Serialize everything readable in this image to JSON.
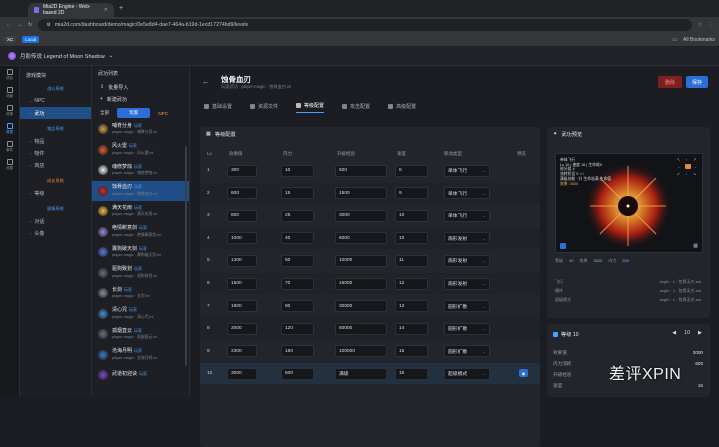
{
  "browser": {
    "tab_title": "Mia2D Engine - Web-based 2D",
    "url": "mia2d.com/dashboard/demo/magic/0e5e8d4-dae7-464a-b19d-1ecd17274bd9/levels",
    "bookmarks_label": "All Bookmarks",
    "chip1": "XC",
    "chip2": "Local"
  },
  "app": {
    "project": "月影传说 Legend of Moon Shadow"
  },
  "rail": [
    "项目",
    "场景",
    "资源",
    "数据",
    "事件",
    "设置"
  ],
  "tree": {
    "title": "游戏模块",
    "groups": [
      {
        "label": "战斗系统",
        "nodes": [
          "NPC",
          "武功"
        ]
      },
      {
        "label": "物品系统",
        "nodes": [
          "物品",
          "物件",
          "商店"
        ]
      },
      {
        "label": "成长系统",
        "nodes": [
          "等级"
        ]
      },
      {
        "label": "剧情系统",
        "nodes": [
          "对话",
          "头像"
        ]
      }
    ]
  },
  "list": {
    "title": "武功列表",
    "batch_import": "批量导入",
    "new_skill": "新建武功",
    "filters": [
      "全部",
      "玩家",
      "NPC"
    ],
    "items": [
      {
        "name": "哺脊分身",
        "tag": "玩家",
        "sub": "player-magic · 哺脊分身.ini",
        "color": "#d8a040"
      },
      {
        "name": "风火雷",
        "tag": "玩家",
        "sub": "player-magic · 风火雷.ini",
        "color": "#e06030"
      },
      {
        "name": "魂修梦烛",
        "tag": "玩家",
        "sub": "player-magic · 魂修梦烛.ini",
        "color": "#f0f0f0"
      },
      {
        "name": "蚀骨血刃",
        "tag": "玩家",
        "sub": "player-magic · 蚀骨血刃.ini",
        "color": "#d03030"
      },
      {
        "name": "满天花雨",
        "tag": "玩家",
        "sub": "player-magic · 满天花雨.ini",
        "color": "#f0c040"
      },
      {
        "name": "绝情断意剑",
        "tag": "玩家",
        "sub": "player-magic · 绝情断意剑.ini",
        "color": "#9a8cd8"
      },
      {
        "name": "骤狗破天剑",
        "tag": "玩家",
        "sub": "player-magic · 骤狗破天剑.ini",
        "color": "#5a7ad8"
      },
      {
        "name": "驱狗致划",
        "tag": "玩家",
        "sub": "player-magic · 驱狗致划.ini",
        "color": "#6a6f78"
      },
      {
        "name": "长剑",
        "tag": "玩家",
        "sub": "player-magic · 长剑.ini",
        "color": "#8a8f98"
      },
      {
        "name": "清心咒",
        "tag": "玩家",
        "sub": "player-magic · 清心咒.ini",
        "color": "#4a8fd0"
      },
      {
        "name": "孤烟直云",
        "tag": "玩家",
        "sub": "player-magic · 孤烟直云.ini",
        "color": "#6a7080"
      },
      {
        "name": "沧海月明",
        "tag": "玩家",
        "sub": "player-magic · 沧海月明.ini",
        "color": "#3a7ad0"
      },
      {
        "name": "武道初迎诀",
        "tag": "玩家",
        "sub": "",
        "color": "#7a4ad0"
      }
    ]
  },
  "main": {
    "title": "蚀骨血刃",
    "subtitle": "玩家武功 · player-magic · 蚀骨血刃.ini",
    "delete": "删除",
    "save": "保存",
    "tabs": [
      "基础设置",
      "资源文件",
      "等级配置",
      "攻击配置",
      "高级配置"
    ]
  },
  "levels": {
    "title": "等级配置",
    "headers": [
      "Lv",
      "效果值",
      "内力",
      "升级经验",
      "速度",
      "移动类型",
      "预览"
    ],
    "rows": [
      {
        "lv": "1",
        "eff": "300",
        "mana": "10",
        "exp": "500",
        "speed": "8",
        "move": "单体飞行"
      },
      {
        "lv": "2",
        "eff": "600",
        "mana": "15",
        "exp": "1500",
        "speed": "9",
        "move": "单体飞行"
      },
      {
        "lv": "3",
        "eff": "800",
        "mana": "25",
        "exp": "3000",
        "speed": "10",
        "move": "单体飞行"
      },
      {
        "lv": "4",
        "eff": "1000",
        "mana": "40",
        "exp": "6000",
        "speed": "10",
        "move": "扇形发射"
      },
      {
        "lv": "5",
        "eff": "1300",
        "mana": "50",
        "exp": "10000",
        "speed": "11",
        "move": "扇形发射"
      },
      {
        "lv": "6",
        "eff": "1500",
        "mana": "70",
        "exp": "16000",
        "speed": "12",
        "move": "扇形发射"
      },
      {
        "lv": "7",
        "eff": "1800",
        "mana": "90",
        "exp": "30000",
        "speed": "13",
        "move": "圆形扩散"
      },
      {
        "lv": "8",
        "eff": "2000",
        "mana": "120",
        "exp": "50000",
        "speed": "14",
        "move": "圆形扩散"
      },
      {
        "lv": "9",
        "eff": "2300",
        "mana": "150",
        "exp": "100000",
        "speed": "15",
        "move": "圆形扩散"
      },
      {
        "lv": "10",
        "eff": "3000",
        "mana": "600",
        "exp": "满级",
        "speed": "16",
        "move": "超级模式"
      }
    ]
  },
  "preview": {
    "title": "武功预览",
    "info": [
      "单体飞行",
      "Lv 10 | 速度 16 | 生命耗9",
      "帧分组 4",
      "流转阶设 9 ↑/↑",
      "满级技能 · 升 生命溢满 生命值",
      "效果: 3000"
    ],
    "stats": [
      {
        "k": "等级",
        "v": "40"
      },
      {
        "k": "效果",
        "v": "3000"
      },
      {
        "k": "内力",
        "v": "600"
      }
    ],
    "files": [
      {
        "k": "飞行",
        "v": "asgfx · 1 · 包骨无刃.asf"
      },
      {
        "k": "爆炸",
        "v": "asgfx · 1 · 包骨无刃.asf"
      },
      {
        "k": "超级模式",
        "v": "asgfx · 1 · 包骨无刃.asf"
      }
    ]
  },
  "levelcard": {
    "title": "等级 10",
    "value": "10",
    "rows": [
      {
        "k": "效果值",
        "v": "3000"
      },
      {
        "k": "内力消耗",
        "v": "600"
      },
      {
        "k": "升级经验",
        "v": ""
      },
      {
        "k": "速度",
        "v": "16"
      }
    ]
  },
  "watermark": "差评XPIN"
}
